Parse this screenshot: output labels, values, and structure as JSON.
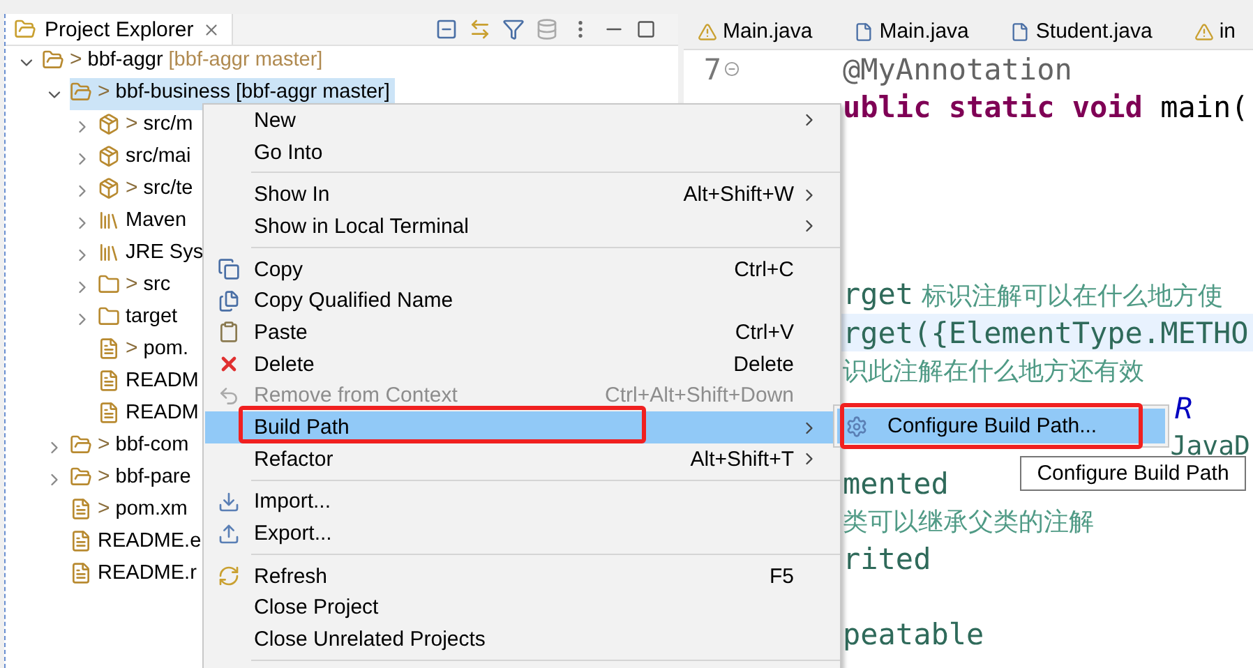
{
  "explorer": {
    "title": "Project Explorer",
    "tree": [
      {
        "label": "bbf-aggr",
        "mark": ">",
        "branch": "[bbf-aggr master]",
        "kind": "project",
        "expanded": true,
        "selected": false,
        "children": [
          {
            "label": "bbf-business [bbf-aggr master]",
            "mark": ">",
            "kind": "project",
            "expanded": true,
            "selected": true,
            "children": [
              {
                "label": "src/m",
                "mark": ">",
                "kind": "package",
                "expanded": false,
                "selected": false
              },
              {
                "label": "src/mai",
                "kind": "package",
                "expanded": false,
                "selected": false
              },
              {
                "label": "src/te",
                "mark": ">",
                "kind": "package",
                "expanded": false,
                "selected": false
              },
              {
                "label": "Maven",
                "kind": "library",
                "expanded": false,
                "selected": false
              },
              {
                "label": "JRE Sys",
                "kind": "library",
                "expanded": false,
                "selected": false
              },
              {
                "label": "src",
                "mark": ">",
                "kind": "folder",
                "expanded": false,
                "selected": false
              },
              {
                "label": "target",
                "kind": "folder",
                "expanded": false,
                "selected": false
              },
              {
                "label": "pom.",
                "mark": ">",
                "kind": "file",
                "selected": false
              },
              {
                "label": "READM",
                "kind": "file",
                "selected": false
              },
              {
                "label": "READM",
                "kind": "file",
                "selected": false
              }
            ]
          },
          {
            "label": "bbf-com",
            "mark": ">",
            "kind": "project",
            "expanded": false,
            "selected": false
          },
          {
            "label": "bbf-pare",
            "mark": ">",
            "kind": "project",
            "expanded": false,
            "selected": false
          },
          {
            "label": "pom.xm",
            "mark": ">",
            "kind": "file",
            "selected": false
          },
          {
            "label": "README.e",
            "kind": "file",
            "selected": false
          },
          {
            "label": "README.r",
            "kind": "file",
            "selected": false
          }
        ]
      }
    ]
  },
  "editor": {
    "tabs": [
      {
        "label": "Main.java",
        "warning": true,
        "selected": false
      },
      {
        "label": "Main.java",
        "warning": false,
        "selected": false
      },
      {
        "label": "Student.java",
        "warning": false,
        "selected": false
      },
      {
        "label": "in",
        "warning": true,
        "selected": false
      }
    ],
    "line_numbers": [
      "7"
    ],
    "lines": [
      {
        "kind": "code",
        "segments": [
          {
            "text": "@MyAnnotation",
            "kind": "annotation-name"
          }
        ]
      },
      {
        "kind": "code",
        "segments": [
          {
            "text": "ublic static void",
            "kind": "keyword"
          },
          {
            "text": " main(",
            "kind": "plain"
          }
        ]
      },
      {
        "kind": "blank"
      },
      {
        "kind": "blank"
      },
      {
        "kind": "blank"
      },
      {
        "kind": "blank"
      },
      {
        "kind": "code",
        "segments": [
          {
            "text": "rget",
            "kind": "annotation"
          },
          {
            "text": " 标识注解可以在什么地方使",
            "kind": "comment"
          }
        ]
      },
      {
        "kind": "code",
        "current": true,
        "segments": [
          {
            "text": "rget({ElementType.METHO",
            "kind": "annotation"
          }
        ]
      },
      {
        "kind": "code",
        "segments": [
          {
            "text": "识此注解在什么地方还有效",
            "kind": "comment"
          }
        ]
      },
      {
        "kind": "covered",
        "segments": [
          {
            "text": "R",
            "kind": "constant"
          }
        ]
      },
      {
        "kind": "edge",
        "segments": [
          {
            "text": "JavaD",
            "kind": "annotation"
          }
        ]
      },
      {
        "kind": "code",
        "segments": [
          {
            "text": "mented",
            "kind": "annotation"
          }
        ]
      },
      {
        "kind": "code",
        "segments": [
          {
            "text": "类可以继承父类的注解",
            "kind": "comment"
          }
        ]
      },
      {
        "kind": "code",
        "segments": [
          {
            "text": "rited",
            "kind": "annotation"
          }
        ]
      },
      {
        "kind": "blank"
      },
      {
        "kind": "code",
        "segments": [
          {
            "text": "peatable",
            "kind": "annotation"
          }
        ]
      }
    ]
  },
  "context_menu": {
    "items": [
      {
        "kind": "item",
        "label": "New",
        "submenu": true,
        "selected": false,
        "disabled": false
      },
      {
        "kind": "item",
        "label": "Go Into",
        "selected": false,
        "disabled": false
      },
      {
        "kind": "separator"
      },
      {
        "kind": "item",
        "label": "Show In",
        "shortcut": "Alt+Shift+W",
        "submenu": true,
        "selected": false,
        "disabled": false
      },
      {
        "kind": "item",
        "label": "Show in Local Terminal",
        "submenu": true,
        "selected": false,
        "disabled": false
      },
      {
        "kind": "separator"
      },
      {
        "kind": "copy",
        "label": "Copy",
        "shortcut": "Ctrl+C",
        "selected": false,
        "disabled": false
      },
      {
        "kind": "copy-name",
        "label": "Copy Qualified Name",
        "selected": false,
        "disabled": false
      },
      {
        "kind": "paste",
        "label": "Paste",
        "shortcut": "Ctrl+V",
        "selected": false,
        "disabled": false
      },
      {
        "kind": "delete",
        "label": "Delete",
        "shortcut": "Delete",
        "selected": false,
        "disabled": false
      },
      {
        "kind": "remove",
        "label": "Remove from Context",
        "shortcut": "Ctrl+Alt+Shift+Down",
        "selected": false,
        "disabled": true
      },
      {
        "kind": "item",
        "label": "Build Path",
        "submenu": true,
        "selected": true,
        "disabled": false,
        "highlighted": true
      },
      {
        "kind": "item",
        "label": "Refactor",
        "shortcut": "Alt+Shift+T",
        "submenu": true,
        "selected": false,
        "disabled": false
      },
      {
        "kind": "separator"
      },
      {
        "kind": "import",
        "label": "Import...",
        "selected": false,
        "disabled": false
      },
      {
        "kind": "export",
        "label": "Export...",
        "selected": false,
        "disabled": false
      },
      {
        "kind": "separator"
      },
      {
        "kind": "refresh",
        "label": "Refresh",
        "shortcut": "F5",
        "selected": false,
        "disabled": false
      },
      {
        "kind": "item",
        "label": "Close Project",
        "selected": false,
        "disabled": false
      },
      {
        "kind": "item",
        "label": "Close Unrelated Projects",
        "selected": false,
        "disabled": false
      },
      {
        "kind": "separator"
      }
    ]
  },
  "submenu": {
    "items": [
      {
        "label": "Configure Build Path...",
        "selected": true,
        "highlighted": true
      }
    ]
  },
  "tooltip": {
    "text": "Configure Build Path"
  }
}
